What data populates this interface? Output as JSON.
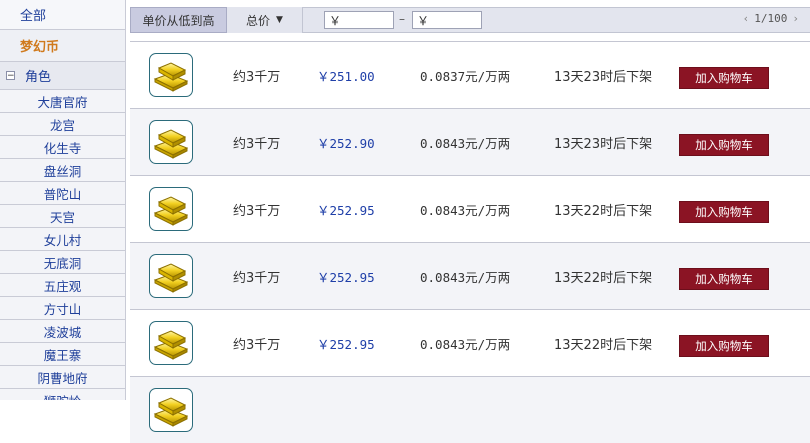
{
  "sidebar": {
    "all_label": "全部",
    "coin_label": "梦幻币",
    "role_toggle": "−",
    "role_label": "角色",
    "sub_items": [
      "大唐官府",
      "龙宫",
      "化生寺",
      "盘丝洞",
      "普陀山",
      "天宫",
      "女儿村",
      "无底洞",
      "五庄观",
      "方寸山",
      "凌波城",
      "魔王寨",
      "阴曹地府",
      "狮驼岭"
    ]
  },
  "filter": {
    "sort_unit_label": "单价从低到高",
    "sort_total_label": "总价",
    "min_price_value": "￥",
    "max_price_value": "￥",
    "range_dash": "–",
    "pager_prev": "‹",
    "pager_text": "1/100",
    "pager_next": "›"
  },
  "rows": [
    {
      "amount": "约3千万",
      "price": "￥251.00",
      "unit_price": "0.0837元/万两",
      "time_left": "13天23时后下架",
      "button": "加入购物车"
    },
    {
      "amount": "约3千万",
      "price": "￥252.90",
      "unit_price": "0.0843元/万两",
      "time_left": "13天23时后下架",
      "button": "加入购物车"
    },
    {
      "amount": "约3千万",
      "price": "￥252.95",
      "unit_price": "0.0843元/万两",
      "time_left": "13天22时后下架",
      "button": "加入购物车"
    },
    {
      "amount": "约3千万",
      "price": "￥252.95",
      "unit_price": "0.0843元/万两",
      "time_left": "13天22时后下架",
      "button": "加入购物车"
    },
    {
      "amount": "约3千万",
      "price": "￥252.95",
      "unit_price": "0.0843元/万两",
      "time_left": "13天22时后下架",
      "button": "加入购物车"
    },
    {
      "amount": "",
      "price": "",
      "unit_price": "",
      "time_left": "",
      "button": ""
    }
  ],
  "icons": {
    "row_thumbnail": "gold-bars-icon",
    "sort_chevron": "chevron-down-icon",
    "role_toggle": "collapse-icon"
  },
  "colors": {
    "accent_red": "#8b1424",
    "price_blue": "#1f3fa8",
    "coin_orange": "#d07a1d",
    "link_blue": "#1f3f9a"
  }
}
